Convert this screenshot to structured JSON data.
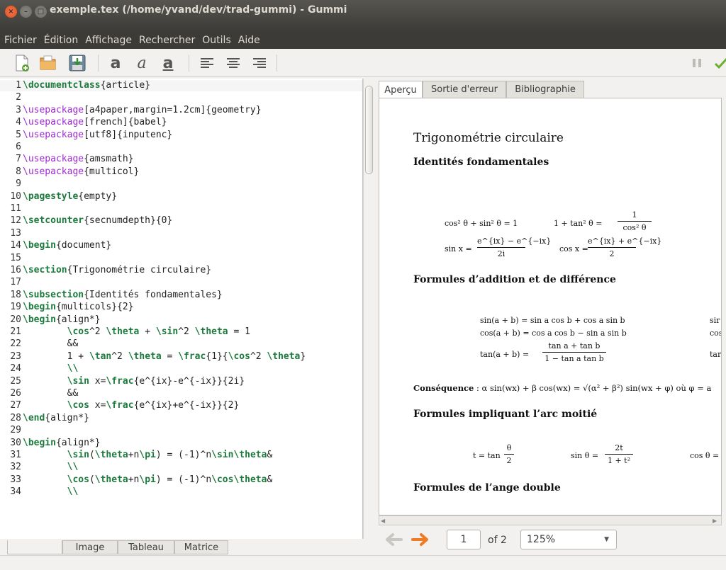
{
  "window": {
    "title": "exemple.tex (/home/yvand/dev/trad-gummi) - Gummi"
  },
  "menu": [
    "Fichier",
    "Édition",
    "Affichage",
    "Rechercher",
    "Outils",
    "Aide"
  ],
  "toolbar": {
    "icons": [
      "new-file-icon",
      "open-folder-icon",
      "save-icon",
      "bold-icon",
      "italic-icon",
      "underline-icon",
      "align-left-icon",
      "align-center-icon",
      "align-right-icon",
      "pause-icon",
      "check-icon"
    ],
    "bold_glyph": "a",
    "italic_glyph": "a",
    "underline_glyph": "a"
  },
  "editor": {
    "lines": [
      {
        "n": "1",
        "html": "<span class='k'>\\documentclass</span>{article}"
      },
      {
        "n": "2",
        "html": ""
      },
      {
        "n": "3",
        "html": "<span class='p'>\\usepackage</span>[a4paper,margin=1.2cm]{geometry}"
      },
      {
        "n": "4",
        "html": "<span class='p'>\\usepackage</span>[french]{babel}"
      },
      {
        "n": "5",
        "html": "<span class='p'>\\usepackage</span>[utf8]{inputenc}"
      },
      {
        "n": "6",
        "html": ""
      },
      {
        "n": "7",
        "html": "<span class='p'>\\usepackage</span>{amsmath}"
      },
      {
        "n": "8",
        "html": "<span class='p'>\\usepackage</span>{multicol}"
      },
      {
        "n": "9",
        "html": ""
      },
      {
        "n": "10",
        "html": "<span class='k'>\\pagestyle</span>{empty}"
      },
      {
        "n": "11",
        "html": ""
      },
      {
        "n": "12",
        "html": "<span class='k'>\\setcounter</span>{secnumdepth}{0}"
      },
      {
        "n": "13",
        "html": ""
      },
      {
        "n": "14",
        "html": "<span class='k'>\\begin</span>{document}"
      },
      {
        "n": "15",
        "html": ""
      },
      {
        "n": "16",
        "html": "<span class='k'>\\section</span>{Trigonométrie circulaire}"
      },
      {
        "n": "17",
        "html": ""
      },
      {
        "n": "18",
        "html": "<span class='k'>\\subsection</span>{Identités fondamentales}"
      },
      {
        "n": "19",
        "html": "<span class='k'>\\begin</span>{multicols}{2}"
      },
      {
        "n": "20",
        "html": "<span class='k'>\\begin</span>{align*}"
      },
      {
        "n": "21",
        "html": "        <span class='k'>\\cos</span>^2 <span class='k'>\\theta</span> + <span class='k'>\\sin</span>^2 <span class='k'>\\theta</span> = 1"
      },
      {
        "n": "22",
        "html": "        &amp;&amp;"
      },
      {
        "n": "23",
        "html": "        1 + <span class='k'>\\tan</span>^2 <span class='k'>\\theta</span> = <span class='k'>\\frac</span>{1}{<span class='k'>\\cos</span>^2 <span class='k'>\\theta</span>}"
      },
      {
        "n": "24",
        "html": "        <span class='k'>\\\\</span>"
      },
      {
        "n": "25",
        "html": "        <span class='k'>\\sin</span> x=<span class='k'>\\frac</span>{e^{ix}-e^{-ix}}{2i}"
      },
      {
        "n": "26",
        "html": "        &amp;&amp;"
      },
      {
        "n": "27",
        "html": "        <span class='k'>\\cos</span> x=<span class='k'>\\frac</span>{e^{ix}+e^{-ix}}{2}"
      },
      {
        "n": "28",
        "html": "<span class='k'>\\end</span>{align*}"
      },
      {
        "n": "29",
        "html": ""
      },
      {
        "n": "30",
        "html": "<span class='k'>\\begin</span>{align*}"
      },
      {
        "n": "31",
        "html": "        <span class='k'>\\sin</span>(<span class='k'>\\theta</span>+n<span class='k'>\\pi</span>) = (-1)^n<span class='k'>\\sin\\theta</span>&amp;"
      },
      {
        "n": "32",
        "html": "        <span class='k'>\\\\</span>"
      },
      {
        "n": "33",
        "html": "        <span class='k'>\\cos</span>(<span class='k'>\\theta</span>+n<span class='k'>\\pi</span>) = (-1)^n<span class='k'>\\cos\\theta</span>&amp;"
      },
      {
        "n": "34",
        "html": "        <span class='k'>\\\\</span>"
      }
    ]
  },
  "bottom_tabs": [
    "Image",
    "Tableau",
    "Matrice"
  ],
  "preview_tabs": [
    "Aperçu",
    "Sortie d'erreur",
    "Bibliographie"
  ],
  "preview": {
    "section_title": "Trigonométrie circulaire",
    "sub1": "Identités fondamentales",
    "eq1a": "cos² θ + sin² θ = 1",
    "eq1b_left": "1 + tan² θ =",
    "eq1b_num": "1",
    "eq1b_den": "cos² θ",
    "eq2a_left": "sin x =",
    "eq2a_num": "e^{ix} − e^{−ix}",
    "eq2a_den": "2i",
    "eq2b_left": "cos x =",
    "eq2b_num": "e^{ix} + e^{−ix}",
    "eq2b_den": "2",
    "sub2": "Formules d’addition et de différence",
    "add1": "sin(a + b) = sin a cos b + cos a sin b",
    "add1r": "sir",
    "add2": "cos(a + b) = cos a cos b − sin a sin b",
    "add2r": "cos",
    "add3_left": "tan(a + b) =",
    "add3_num": "tan a + tan b",
    "add3_den": "1 − tan a tan b",
    "add3r": "tar",
    "consequence_label": "Conséquence",
    "consequence_text": ": α sin(wx) + β cos(wx) = √(α² + β²) sin(wx + φ) où φ = a",
    "sub3": "Formules impliquant l’arc moitié",
    "half1_left": "t = tan",
    "half1_num": "θ",
    "half1_den": "2",
    "half2_left": "sin θ =",
    "half2_num": "2t",
    "half2_den": "1 + t²",
    "half3": "cos θ =",
    "sub4": "Formules de l’ange double"
  },
  "nav": {
    "page": "1",
    "of_label": "of 2",
    "zoom": "125%"
  }
}
